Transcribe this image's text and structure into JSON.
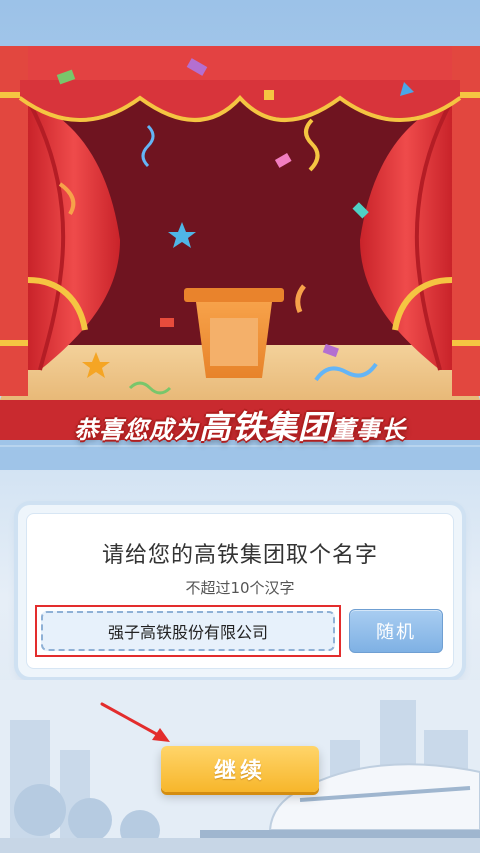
{
  "banner": {
    "congrats_prefix": "恭喜您成为",
    "company_highlight": "高铁集团",
    "title_suffix": "董事长"
  },
  "card": {
    "title": "请给您的高铁集团取个名字",
    "subtitle": "不超过10个汉字",
    "name_value": "强子高铁股份有限公司",
    "random_label": "随机"
  },
  "footer": {
    "continue_label": "继续"
  },
  "colors": {
    "curtain": "#e23b3b",
    "highlight_border": "#e32d2d",
    "continue_button": "#f7b62b",
    "random_button": "#8fbbe8"
  },
  "icons": {
    "arrow": "pointer-arrow-icon"
  }
}
